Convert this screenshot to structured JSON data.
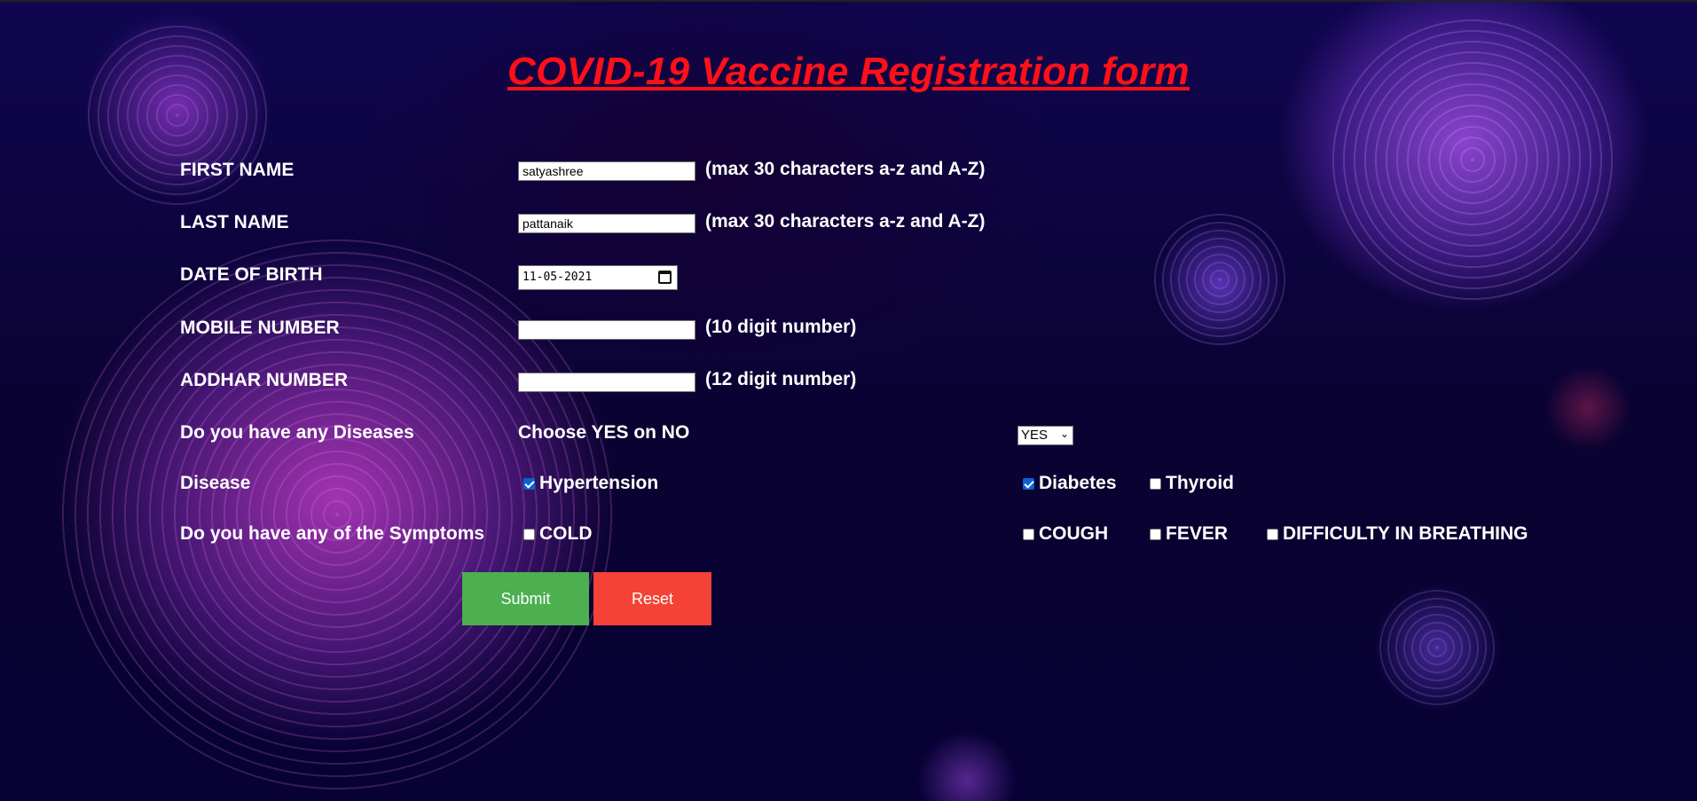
{
  "title": "COVID-19 Vaccine Registration form",
  "fields": {
    "first_name": {
      "label": "FIRST NAME",
      "value": "satyashree",
      "hint": "(max 30 characters a-z and A-Z)"
    },
    "last_name": {
      "label": "LAST NAME",
      "value": "pattanaik",
      "hint": "(max 30 characters a-z and A-Z)"
    },
    "dob": {
      "label": "DATE OF BIRTH",
      "value": "11-05-2021"
    },
    "mobile": {
      "label": "MOBILE NUMBER",
      "value": "",
      "hint": "(10 digit number)"
    },
    "addhar": {
      "label": "ADDHAR NUMBER",
      "value": "",
      "hint": "(12 digit number)"
    }
  },
  "diseases_question": {
    "label": "Do you have any Diseases",
    "prompt": "Choose YES on NO",
    "selected": "YES"
  },
  "disease": {
    "label": "Disease",
    "options": [
      {
        "label": "Hypertension",
        "checked": true
      },
      {
        "label": "Diabetes",
        "checked": true
      },
      {
        "label": "Thyroid",
        "checked": false
      }
    ]
  },
  "symptoms": {
    "label": "Do you have any of the Symptoms",
    "options": [
      {
        "label": "COLD",
        "checked": false
      },
      {
        "label": "COUGH",
        "checked": false
      },
      {
        "label": "FEVER",
        "checked": false
      },
      {
        "label": "DIFFICULTY IN BREATHING",
        "checked": false
      }
    ]
  },
  "buttons": {
    "submit": "Submit",
    "reset": "Reset"
  },
  "colors": {
    "title": "#ff1018",
    "submit": "#4caf50",
    "reset": "#f44336",
    "checkbox_checked": "#0b62d6"
  },
  "icons": {
    "date_picker": "calendar-icon",
    "select": "chevron-down-icon"
  }
}
